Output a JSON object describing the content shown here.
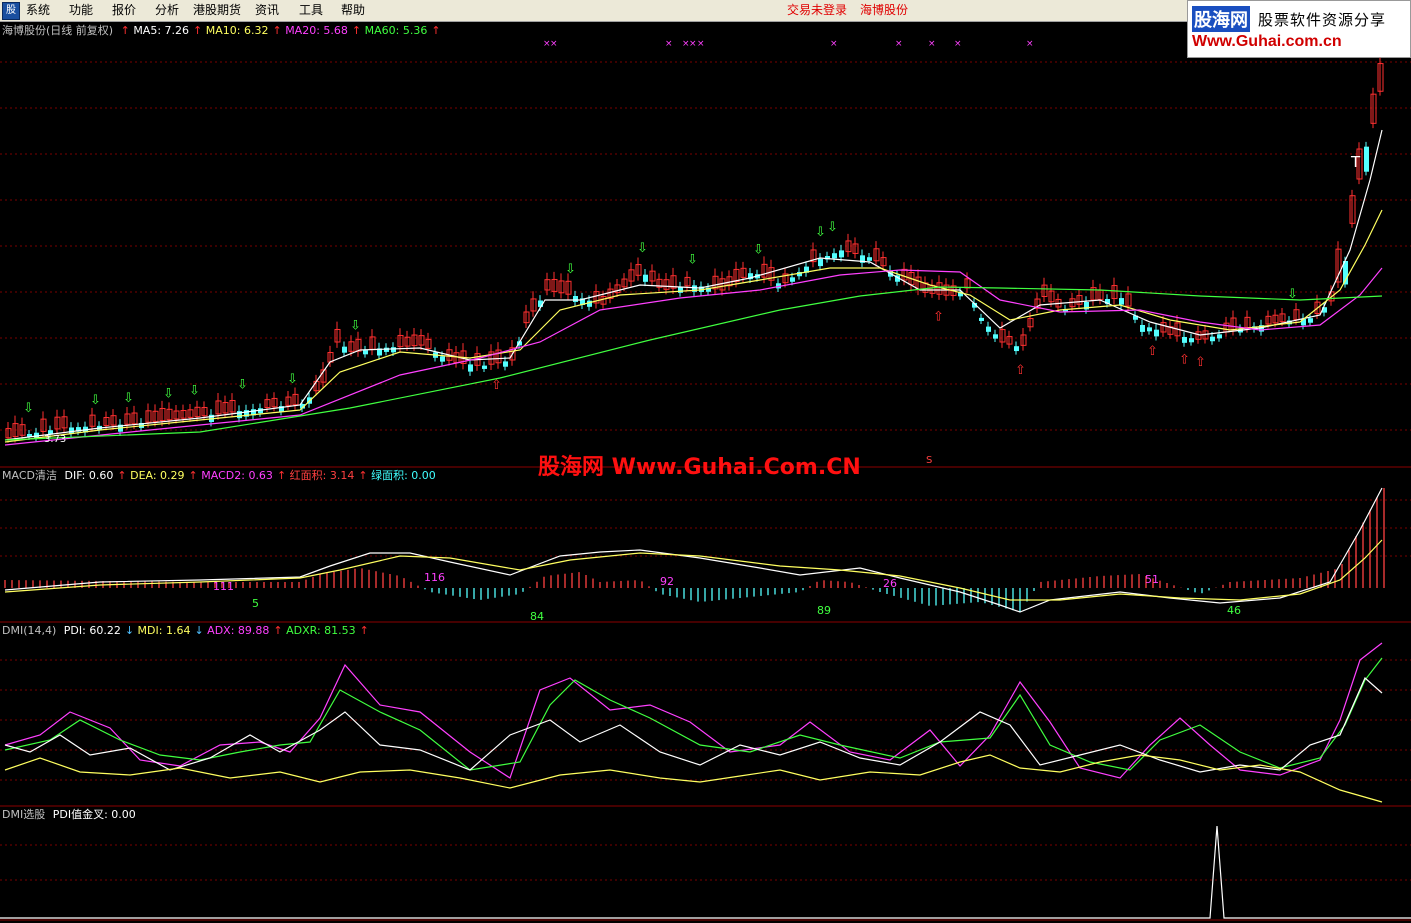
{
  "menu": {
    "items": [
      "系统",
      "功能",
      "报价",
      "分析",
      "港股期货",
      "资讯",
      "工具",
      "帮助"
    ],
    "status": "交易未登录",
    "stock": "海博股份"
  },
  "logo": {
    "name": "股海网",
    "slogan": "股票软件资源分享",
    "url": "Www.Guhai.com.cn"
  },
  "watermark": "股海网 Www.Guhai.Com.CN",
  "main": {
    "title": "海博股份(日线 前复权)",
    "indicators": [
      {
        "label": "MA5: 7.26",
        "color": "#ffffff"
      },
      {
        "label": "MA10: 6.32",
        "color": "#ffff60"
      },
      {
        "label": "MA20: 5.68",
        "color": "#ff40ff"
      },
      {
        "label": "MA60: 5.36",
        "color": "#40ff40"
      }
    ],
    "low_label": "3.73",
    "t_label": "T",
    "s_label": "S"
  },
  "macd": {
    "title": "MACD清洁",
    "indicators": [
      {
        "label": "DIF: 0.60",
        "color": "#ffffff",
        "arrow": "up"
      },
      {
        "label": "DEA: 0.29",
        "color": "#ffff60",
        "arrow": "up"
      },
      {
        "label": "MACD2: 0.63",
        "color": "#ff40ff",
        "arrow": "up"
      },
      {
        "label": "红面积: 3.14",
        "color": "#ff4040",
        "arrow": "up"
      },
      {
        "label": "绿面积: 0.00",
        "color": "#40ffff",
        "arrow": ""
      }
    ],
    "area_labels": [
      {
        "text": "111",
        "color": "#ff40ff"
      },
      {
        "text": "5",
        "color": "#40ff40"
      },
      {
        "text": "116",
        "color": "#ff40ff"
      },
      {
        "text": "84",
        "color": "#40ff40"
      },
      {
        "text": "92",
        "color": "#ff40ff"
      },
      {
        "text": "89",
        "color": "#40ff40"
      },
      {
        "text": "26",
        "color": "#ff40ff"
      },
      {
        "text": "51",
        "color": "#ff40ff"
      },
      {
        "text": "46",
        "color": "#40ff40"
      }
    ]
  },
  "dmi": {
    "title": "DMI(14,4)",
    "indicators": [
      {
        "label": "PDI: 60.22",
        "color": "#ffffff",
        "arrow": "down"
      },
      {
        "label": "MDI: 1.64",
        "color": "#ffff60",
        "arrow": "down"
      },
      {
        "label": "ADX: 89.88",
        "color": "#ff40ff",
        "arrow": "up"
      },
      {
        "label": "ADXR: 81.53",
        "color": "#40ff40",
        "arrow": "up"
      }
    ]
  },
  "dmi_select": {
    "title": "DMI选股",
    "indicators": [
      {
        "label": "PDI值金叉: 0.00",
        "color": "#ffffff",
        "arrow": ""
      }
    ]
  },
  "colors": {
    "bg": "#000000",
    "grid": "#8b0000",
    "up": "#ff3030",
    "down": "#54ffff"
  }
}
